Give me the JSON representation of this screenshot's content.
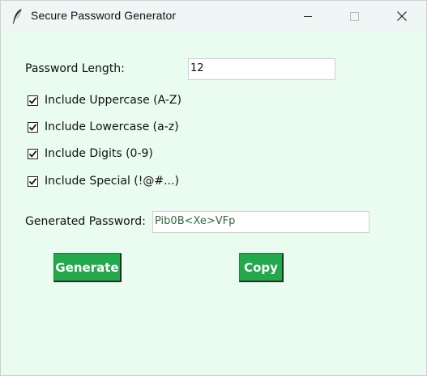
{
  "window": {
    "title": "Secure Password Generator",
    "controls": [
      "minimize",
      "maximize",
      "close"
    ]
  },
  "form": {
    "length_label": "Password Length:",
    "length_value": "12",
    "options": [
      {
        "label": "Include Uppercase (A-Z)",
        "checked": true
      },
      {
        "label": "Include Lowercase (a-z)",
        "checked": true
      },
      {
        "label": "Include Digits (0-9)",
        "checked": true
      },
      {
        "label": "Include Special (!@#...)",
        "checked": true
      }
    ],
    "generated_label": "Generated Password:",
    "generated_value": "Pib0B<Xe>VFp"
  },
  "buttons": {
    "generate_label": "Generate",
    "copy_label": "Copy"
  },
  "colors": {
    "background": "#eafbef",
    "button": "#21a94b",
    "password_text": "#2e6b3f"
  }
}
